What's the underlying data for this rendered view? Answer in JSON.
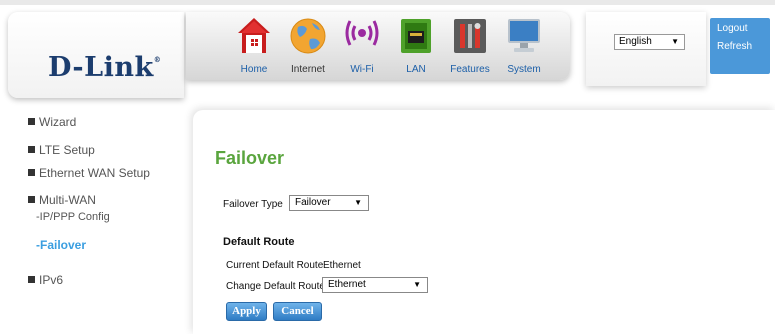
{
  "brand": {
    "name": "D-Link",
    "mark": "®"
  },
  "nav": [
    {
      "key": "home",
      "label": "Home",
      "icon": "home-icon"
    },
    {
      "key": "internet",
      "label": "Internet",
      "icon": "globe-icon"
    },
    {
      "key": "wifi",
      "label": "Wi-Fi",
      "icon": "wifi-icon"
    },
    {
      "key": "lan",
      "label": "LAN",
      "icon": "lan-port-icon"
    },
    {
      "key": "features",
      "label": "Features",
      "icon": "tools-icon"
    },
    {
      "key": "system",
      "label": "System",
      "icon": "monitor-icon"
    }
  ],
  "language": {
    "selected": "English"
  },
  "account": {
    "logout": "Logout",
    "refresh": "Refresh"
  },
  "sidebar": {
    "items": [
      {
        "label": "Wizard"
      },
      {
        "label": "LTE Setup"
      },
      {
        "label": "Ethernet WAN Setup"
      },
      {
        "label": "Multi-WAN"
      },
      {
        "label": "IPv6"
      }
    ],
    "subitems": [
      {
        "label": "-IP/PPP Config"
      },
      {
        "label": "-Failover",
        "active": true
      }
    ]
  },
  "main": {
    "title": "Failover",
    "failover_type": {
      "label": "Failover Type",
      "value": "Failover"
    },
    "default_route": {
      "heading": "Default Route",
      "current_label": "Current Default Route",
      "current_value": "Ethernet",
      "change_label": "Change Default Route",
      "change_value": "Ethernet"
    },
    "buttons": {
      "apply": "Apply",
      "cancel": "Cancel"
    }
  },
  "colors": {
    "accent_blue": "#4b98d9",
    "title_green": "#5aa53e",
    "active_link": "#3a9ee0",
    "brand_navy": "#1c3d6e"
  }
}
